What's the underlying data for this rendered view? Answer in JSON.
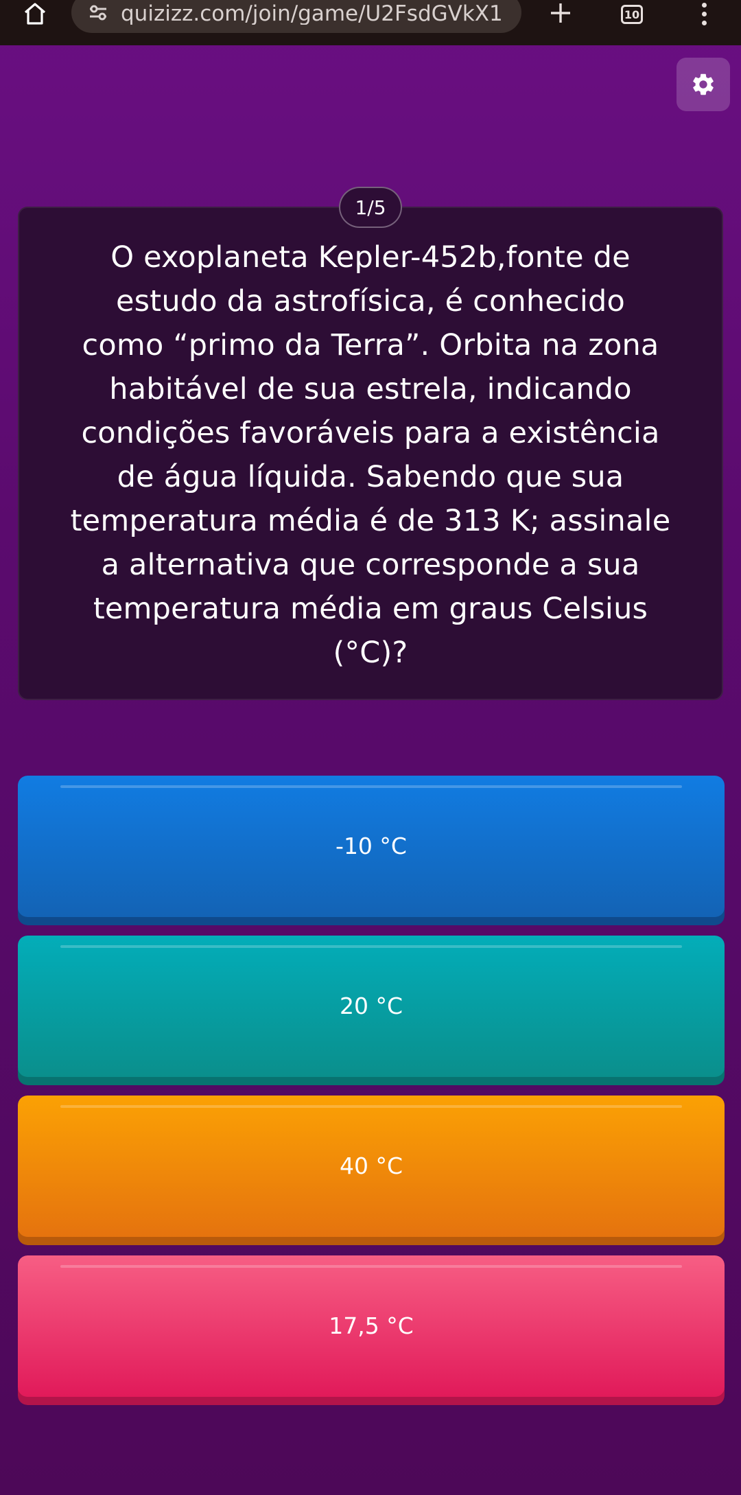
{
  "browser": {
    "url": "quizizz.com/join/game/U2FsdGVkX1",
    "tab_count": "10",
    "icons": {
      "home": "home-icon",
      "site_settings": "tune-icon",
      "new_tab": "plus-icon",
      "menu": "more-vert-icon"
    }
  },
  "quiz": {
    "settings_icon": "gear-icon",
    "counter": "1/5",
    "question": "O exoplaneta Kepler-452b,fonte de\nestudo da astrofísica, é conhecido\ncomo “primo da Terra”. Orbita na zona\nhabitável de sua estrela, indicando\ncondições favoráveis para a existência\nde água líquida. Sabendo que sua\ntemperatura média é de 313 K; assinale\na alternativa que corresponde a sua\ntemperatura média em graus Celsius\n(°C)?",
    "options": [
      {
        "label": "-10 °C",
        "color": "#1272d0"
      },
      {
        "label": "20 °C",
        "color": "#03a2a8"
      },
      {
        "label": "40 °C",
        "color": "#f08d09"
      },
      {
        "label": "17,5 °C",
        "color": "#ec3b6d"
      }
    ]
  },
  "colors": {
    "background": "#5e0c72",
    "card": "#2d0d35",
    "browser_bar": "#1e1312"
  }
}
